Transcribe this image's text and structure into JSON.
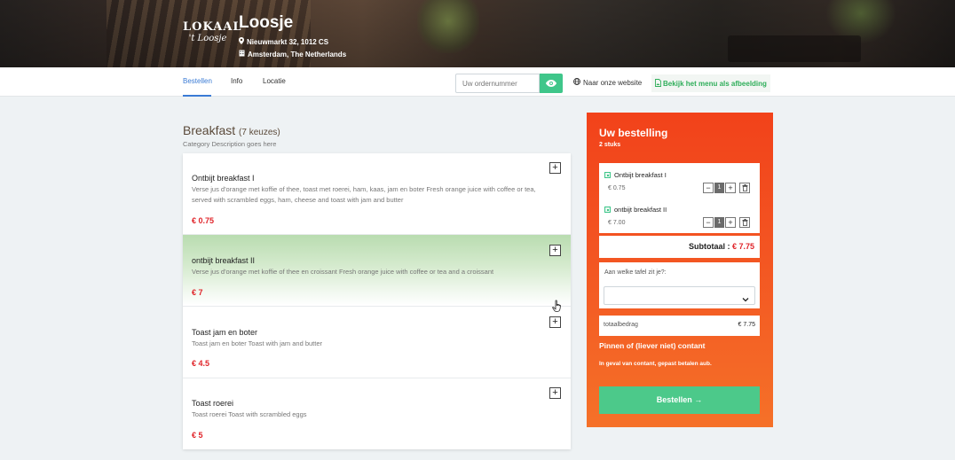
{
  "restaurant": {
    "logo_line1": "LOKAAL",
    "logo_line2": "'t Loosje",
    "name": "Loosje",
    "address_line1": "Nieuwmarkt 32, 1012 CS",
    "address_line2": "Amsterdam, The Netherlands"
  },
  "nav": {
    "tabs": [
      {
        "label": "Bestellen",
        "active": true
      },
      {
        "label": "Info",
        "active": false
      },
      {
        "label": "Locatie",
        "active": false
      }
    ],
    "order_input_placeholder": "Uw ordernummer",
    "website_link": "Naar onze website",
    "menu_image_link": "Bekijk het menu als afbeelding"
  },
  "category": {
    "title": "Breakfast",
    "count": "(7 keuzes)",
    "description": "Category Description goes here",
    "items": [
      {
        "name": "Ontbijt breakfast I",
        "description": "Verse jus d'orange met koffie of thee, toast met roerei, ham, kaas, jam en boter Fresh orange juice with coffee or tea, served with scrambled eggs, ham, cheese and toast with jam and butter",
        "price": "€ 0.75"
      },
      {
        "name": "ontbijt breakfast II",
        "description": "Verse jus d'orange met koffie of thee en croissant Fresh orange juice with coffee or tea and a croissant",
        "price": "€ 7"
      },
      {
        "name": "Toast jam en boter",
        "description": "Toast jam en boter Toast with jam and butter",
        "price": "€ 4.5"
      },
      {
        "name": "Toast roerei",
        "description": "Toast roerei Toast with scrambled eggs",
        "price": "€ 5"
      }
    ]
  },
  "order": {
    "title": "Uw bestelling",
    "count": "2 stuks",
    "lines": [
      {
        "name": "Ontbijt breakfast I",
        "price": "€ 0.75",
        "qty": "1"
      },
      {
        "name": "ontbijt breakfast II",
        "price": "€ 7.00",
        "qty": "1"
      }
    ],
    "subtotal_label": "Subtotaal :",
    "subtotal_value": "€ 7.75",
    "table_question": "Aan welke tafel zit je?:",
    "total_label": "totaalbedrag",
    "total_value": "€ 7.75",
    "payment_title": "Pinnen of (liever niet) contant",
    "payment_note": "In geval van contant, gepast betalen aub.",
    "order_button": "Bestellen →"
  },
  "colors": {
    "accent_blue": "#3a7bd5",
    "green": "#3fc68a",
    "price_red": "#e0242a",
    "order_panel": "#f2421a"
  }
}
